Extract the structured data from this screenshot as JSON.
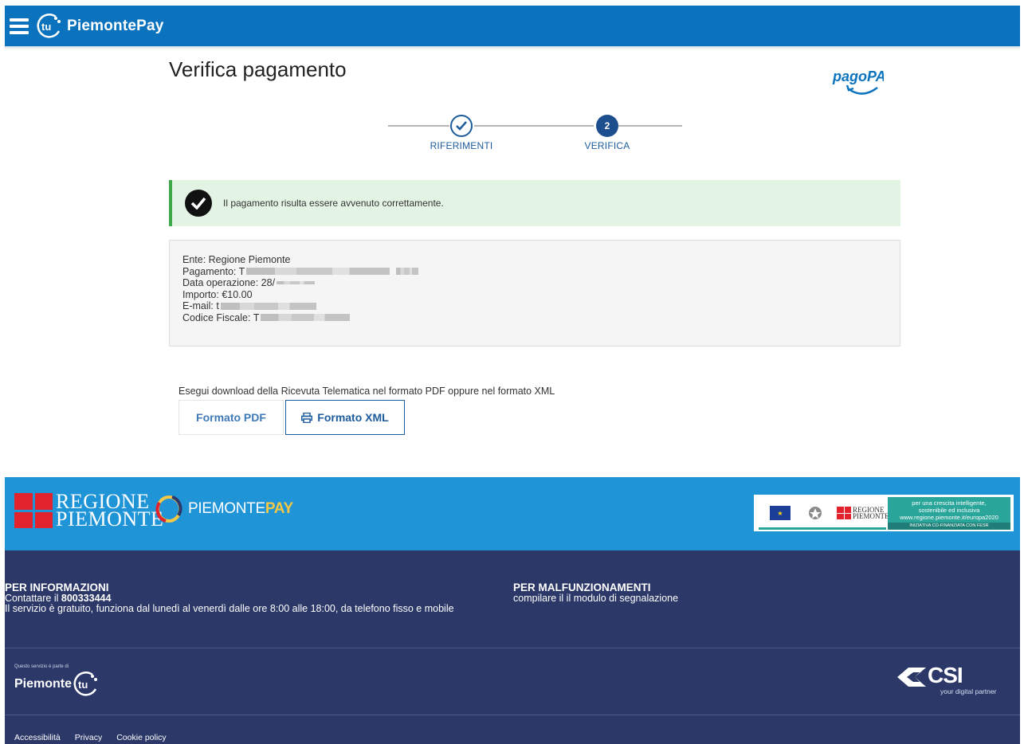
{
  "header": {
    "brand": "PiemontePay",
    "logo_text": "tu"
  },
  "page": {
    "title": "Verifica pagamento",
    "pagopa_logo_text": "pagoPA"
  },
  "stepper": {
    "steps": [
      {
        "number": "1",
        "label": "RIFERIMENTI",
        "state": "done"
      },
      {
        "number": "2",
        "label": "VERIFICA",
        "state": "active"
      }
    ]
  },
  "alert": {
    "message": "Il pagamento risulta essere avvenuto correttamente."
  },
  "details": {
    "ente": "Ente: Regione Piemonte",
    "pagamento_label": "Pagamento: T",
    "data_label": "Data operazione: 28/",
    "importo": "Importo: €10.00",
    "email_label": "E-mail: t",
    "codice_label": "Codice Fiscale: T"
  },
  "download": {
    "instructions": "Esegui download della Ricevuta Telematica nel formato PDF oppure nel formato XML",
    "pdf_label": "Formato PDF",
    "xml_label": "Formato XML"
  },
  "footer": {
    "regione_line1": "REGIONE",
    "regione_line2": "PIEMONTE",
    "piemontepay_a": "PIEMONTE",
    "piemontepay_b": "PAY",
    "eu_tag_line1": "per una crescita intelligente,",
    "eu_tag_line2": "sostenibile ed inclusiva",
    "eu_tag_url": "www.regione.piemonte.it/europa2020",
    "eu_tag_sub": "INIZIATIVA CO-FINANZIATA CON FESR",
    "info_title": "PER INFORMAZIONI",
    "info_line1_prefix": "Contattare il ",
    "info_phone": "800333444",
    "info_line2": "Il servizio è gratuito, funziona dal lunedì al venerdì dalle ore 8:00 alle 18:00, da telefono fisso e mobile",
    "malf_title": "PER MALFUNZIONAMENTI",
    "malf_line": "compilare il il modulo di segnalazione",
    "service_part": "Questo servizio è parte di",
    "piemonte_name": "Piemonte",
    "csi_word": "CSI",
    "csi_sub": "your digital partner",
    "links": [
      "Accessibilità",
      "Privacy",
      "Cookie policy"
    ]
  },
  "colors": {
    "header_blue": "#0b73bd",
    "footer_light_blue": "#1f95d8",
    "footer_dark": "#2b3868",
    "success_green": "#3ea84b",
    "success_bg": "#e4f4e4"
  }
}
